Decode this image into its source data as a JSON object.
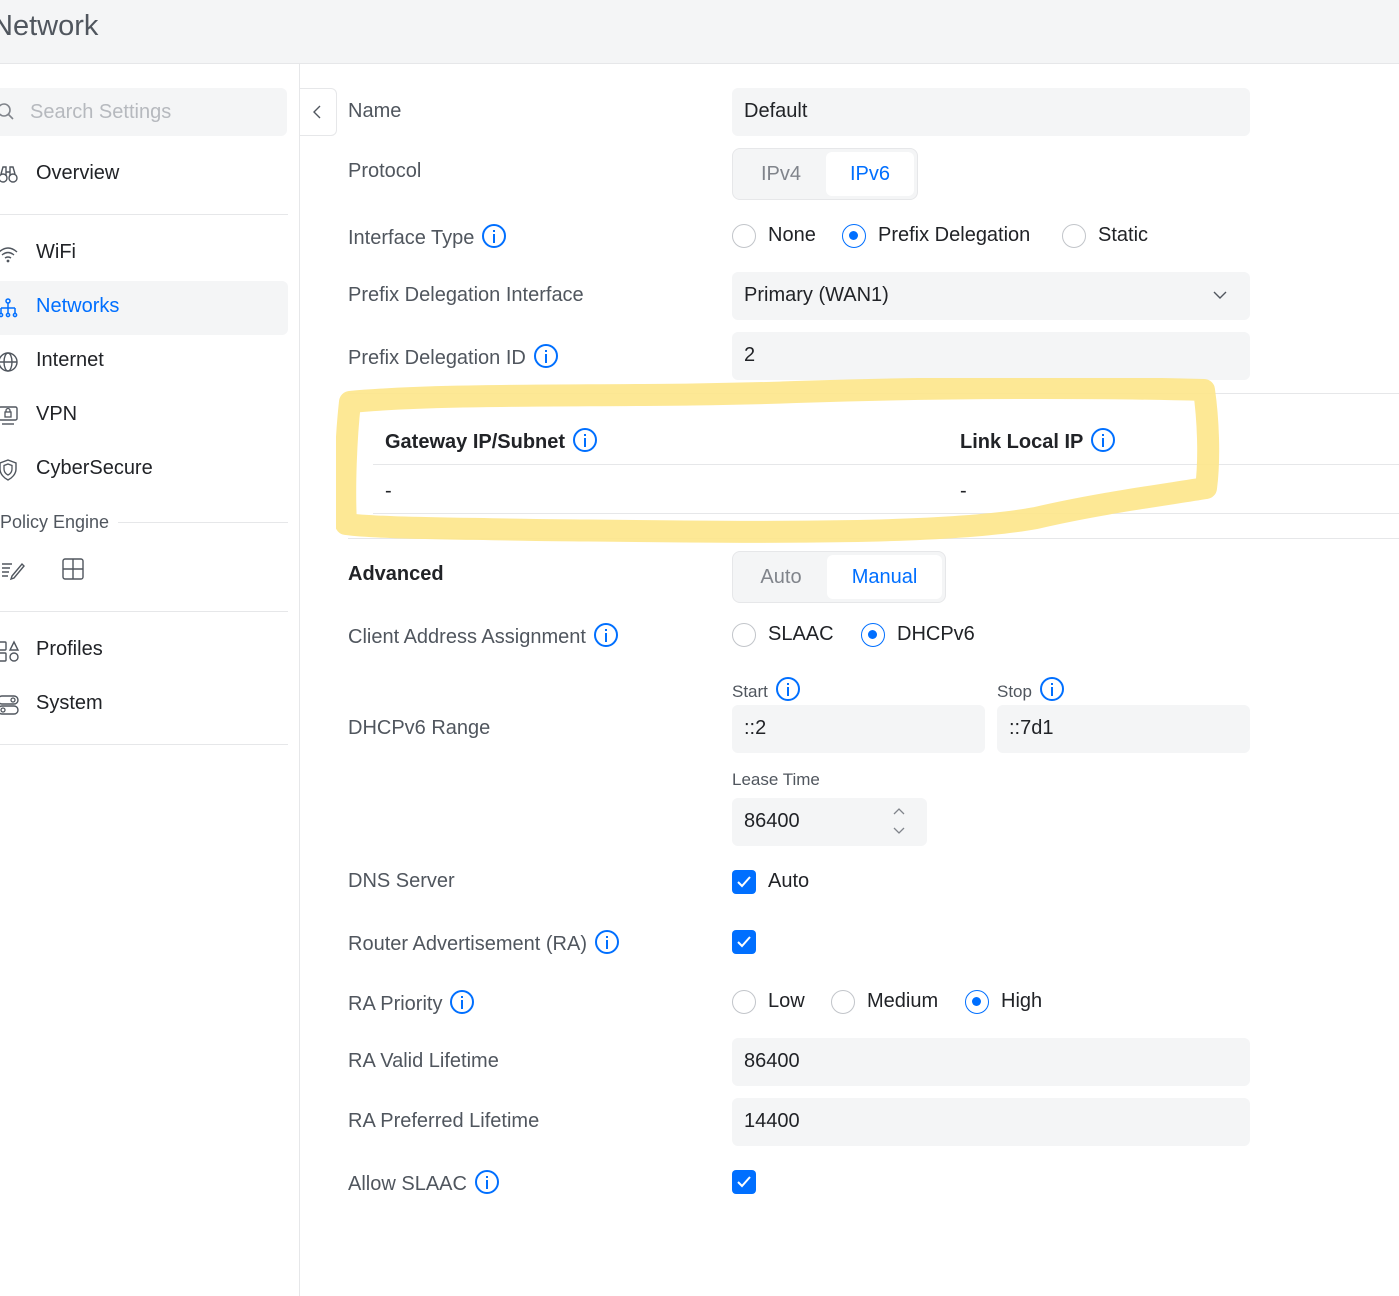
{
  "header": {
    "title": "Network"
  },
  "sidebar": {
    "search_placeholder": "Search Settings",
    "items": [
      {
        "label": "Overview",
        "icon": "binoculars-icon"
      },
      {
        "label": "WiFi",
        "icon": "wifi-icon"
      },
      {
        "label": "Networks",
        "icon": "network-tree-icon",
        "active": true
      },
      {
        "label": "Internet",
        "icon": "globe-icon"
      },
      {
        "label": "VPN",
        "icon": "vpn-monitor-icon"
      },
      {
        "label": "CyberSecure",
        "icon": "shield-icon"
      }
    ],
    "policy_engine_label": "Policy Engine",
    "policy_icons": [
      "pencil-list-icon",
      "grid-icon"
    ],
    "lower_items": [
      {
        "label": "Profiles",
        "icon": "profiles-icon"
      },
      {
        "label": "System",
        "icon": "toggle-icon"
      }
    ]
  },
  "form": {
    "name_label": "Name",
    "name_value": "Default",
    "protocol_label": "Protocol",
    "protocol_options": [
      "IPv4",
      "IPv6"
    ],
    "protocol_selected": "IPv6",
    "interface_type_label": "Interface Type",
    "interface_type_options": [
      "None",
      "Prefix Delegation",
      "Static"
    ],
    "interface_type_selected": "Prefix Delegation",
    "pd_interface_label": "Prefix Delegation Interface",
    "pd_interface_value": "Primary (WAN1)",
    "pd_id_label": "Prefix Delegation ID",
    "pd_id_value": "2",
    "table": {
      "col1": "Gateway IP/Subnet",
      "col2": "Link Local IP",
      "val1": "-",
      "val2": "-"
    },
    "advanced_label": "Advanced",
    "advanced_options": [
      "Auto",
      "Manual"
    ],
    "advanced_selected": "Manual",
    "client_assign_label": "Client Address Assignment",
    "client_assign_options": [
      "SLAAC",
      "DHCPv6"
    ],
    "client_assign_selected": "DHCPv6",
    "dhcp_range_label": "DHCPv6 Range",
    "start_label": "Start",
    "start_value": "::2",
    "stop_label": "Stop",
    "stop_value": "::7d1",
    "lease_label": "Lease Time",
    "lease_value": "86400",
    "dns_label": "DNS Server",
    "dns_auto_label": "Auto",
    "dns_auto_checked": true,
    "ra_label": "Router Advertisement (RA)",
    "ra_checked": true,
    "ra_priority_label": "RA Priority",
    "ra_priority_options": [
      "Low",
      "Medium",
      "High"
    ],
    "ra_priority_selected": "High",
    "ra_valid_label": "RA Valid Lifetime",
    "ra_valid_value": "86400",
    "ra_pref_label": "RA Preferred Lifetime",
    "ra_pref_value": "14400",
    "allow_slaac_label": "Allow SLAAC",
    "allow_slaac_checked": true
  },
  "colors": {
    "accent": "#006fff",
    "highlight": "#fde58a"
  }
}
